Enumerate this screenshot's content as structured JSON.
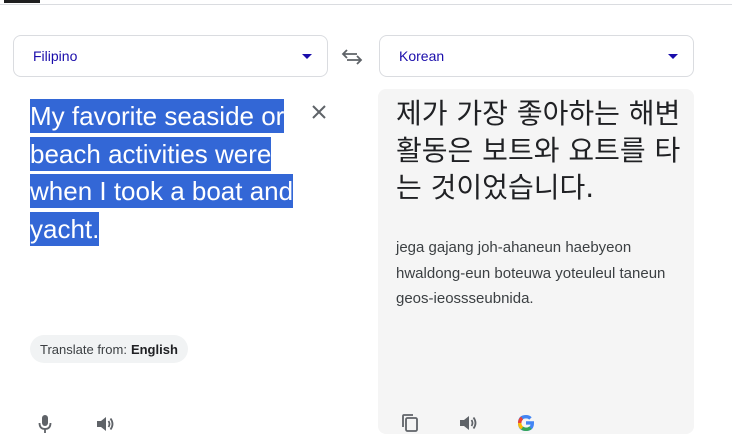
{
  "source": {
    "language_label": "Filipino",
    "text": "My favorite seaside or beach activities were when I took a boat and yacht.",
    "translate_from_prefix": "Translate from:",
    "translate_from_lang": "English"
  },
  "target": {
    "language_label": "Korean",
    "text": "제가 가장 좋아하는 해변 활동은 보트와 요트를 타는 것이었습니다.",
    "romanization": "jega gajang joh-ahaneun haebyeon hwaldong-eun boteuwa yoteuleul taneun geos-ieossseubnida."
  },
  "icons": {
    "swap": "swap-arrows-icon",
    "clear": "close-icon",
    "mic": "microphone-icon",
    "listen": "speaker-icon",
    "copy": "copy-icon",
    "google": "google-logo-icon"
  },
  "colors": {
    "highlight": "#3367d6",
    "language_link": "#1a0dab",
    "panel_bg": "#f5f5f5"
  }
}
